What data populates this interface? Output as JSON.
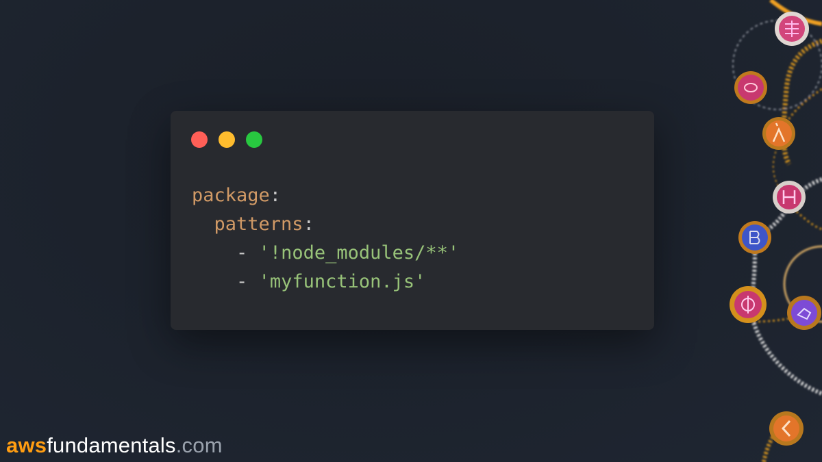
{
  "window_controls": [
    "red",
    "yellow",
    "green"
  ],
  "code": {
    "lines": [
      {
        "key": "package",
        "colon": ":"
      },
      {
        "key": "patterns",
        "colon": ":"
      },
      {
        "dash": "-",
        "str": "'!node_modules/**'"
      },
      {
        "dash": "-",
        "str": "'myfunction.js'"
      }
    ]
  },
  "brand": {
    "aws": "aws",
    "middle": "fundamentals",
    "tld": ".com"
  },
  "colors": {
    "background": "#1f2632",
    "code_bg": "#282a2f",
    "key": "#d19a66",
    "string": "#98c379",
    "brand_orange": "#ff9d12"
  },
  "decor_icons": [
    "api-gateway-icon",
    "network-icon",
    "lambda-icon",
    "http-icon",
    "step-icon",
    "analytics-icon",
    "eventbridge-icon",
    "sqs-icon"
  ]
}
